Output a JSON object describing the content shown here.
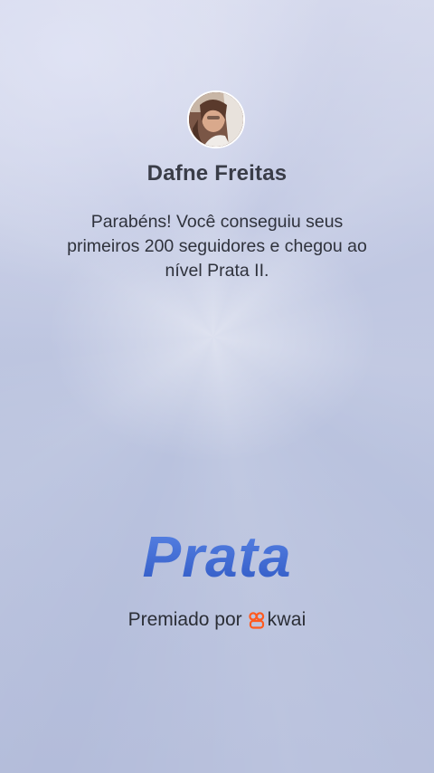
{
  "profile": {
    "name": "Dafne Freitas",
    "avatar_alt": "profile photo"
  },
  "message": "Parabéns! Você conseguiu seus primeiros 200 seguidores e chegou ao nível Prata II.",
  "level": {
    "title": "Prata"
  },
  "footer": {
    "awarded_by": "Premiado por",
    "brand": "kwai",
    "brand_icon": "kwai-logo-icon",
    "brand_color": "#ff5a1f"
  },
  "colors": {
    "level_text": "#3f6bd2",
    "name_text": "#3a3d48"
  }
}
